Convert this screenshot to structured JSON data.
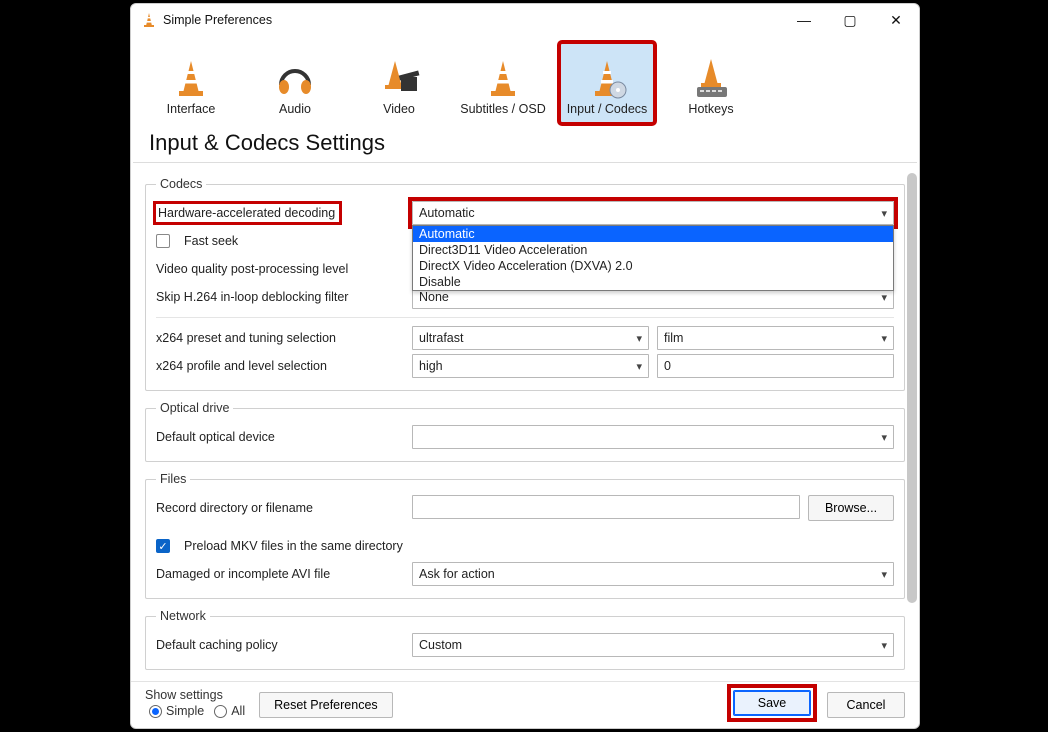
{
  "window": {
    "title": "Simple Preferences"
  },
  "tabs": {
    "interface": "Interface",
    "audio": "Audio",
    "video": "Video",
    "subtitles": "Subtitles / OSD",
    "inputcodecs": "Input / Codecs",
    "hotkeys": "Hotkeys"
  },
  "heading": "Input & Codecs Settings",
  "codecs": {
    "legend": "Codecs",
    "hw_label": "Hardware-accelerated decoding",
    "hw_value": "Automatic",
    "hw_options": {
      "automatic": "Automatic",
      "d3d11": "Direct3D11 Video Acceleration",
      "dxva2": "DirectX Video Acceleration (DXVA) 2.0",
      "disable": "Disable"
    },
    "fastseek": "Fast seek",
    "vq_label": "Video quality post-processing level",
    "skip_label": "Skip H.264 in-loop deblocking filter",
    "skip_value": "None",
    "x264preset_label": "x264 preset and tuning selection",
    "x264preset_value": "ultrafast",
    "x264tune_value": "film",
    "x264profile_label": "x264 profile and level selection",
    "x264profile_value": "high",
    "x264level_value": "0"
  },
  "optical": {
    "legend": "Optical drive",
    "default_label": "Default optical device",
    "default_value": ""
  },
  "files": {
    "legend": "Files",
    "record_label": "Record directory or filename",
    "record_value": "",
    "browse": "Browse...",
    "preload": "Preload MKV files in the same directory",
    "damaged_label": "Damaged or incomplete AVI file",
    "damaged_value": "Ask for action"
  },
  "network": {
    "legend": "Network",
    "cache_label": "Default caching policy",
    "cache_value": "Custom"
  },
  "footer": {
    "show_settings": "Show settings",
    "simple": "Simple",
    "all": "All",
    "reset": "Reset Preferences",
    "save": "Save",
    "cancel": "Cancel"
  }
}
